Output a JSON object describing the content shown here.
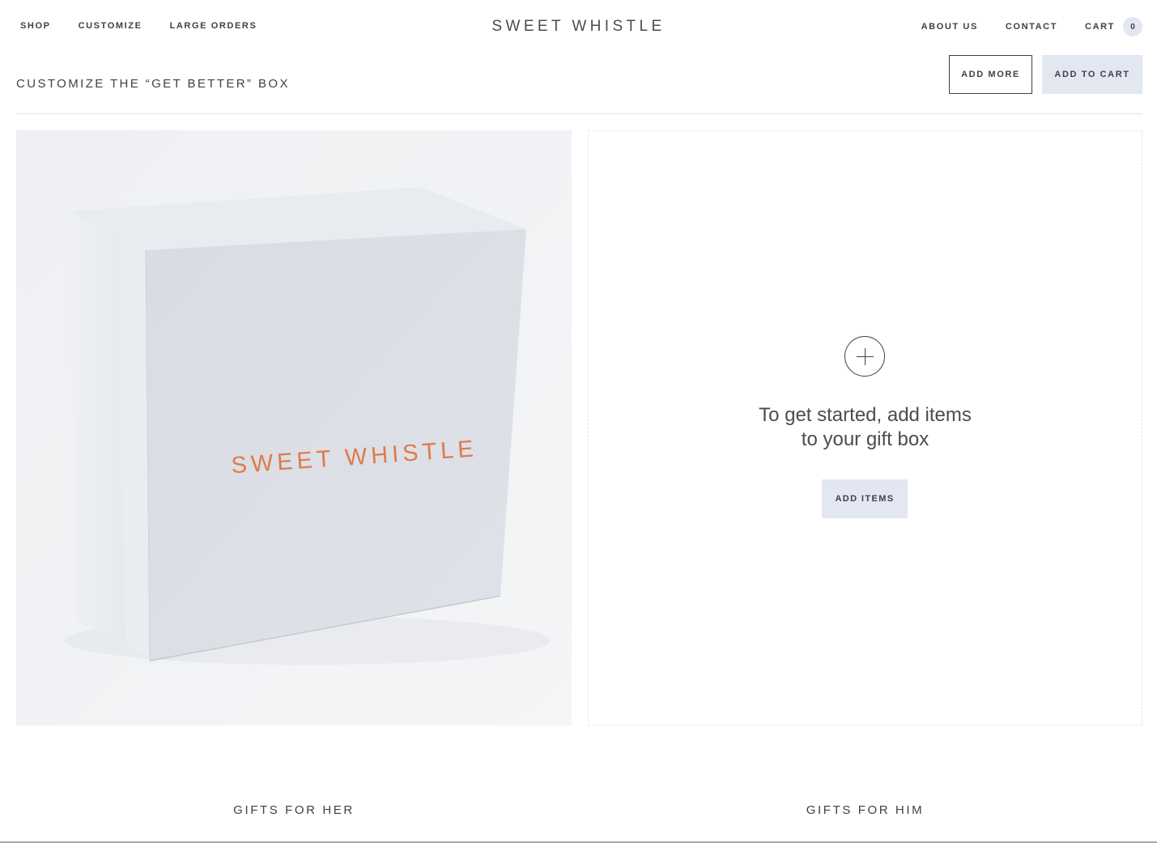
{
  "nav": {
    "left": [
      {
        "label": "SHOP"
      },
      {
        "label": "CUSTOMIZE"
      },
      {
        "label": "LARGE ORDERS"
      }
    ],
    "brand": "SWEET WHISTLE",
    "right": [
      {
        "label": "ABOUT US"
      },
      {
        "label": "CONTACT"
      }
    ],
    "cart_label": "CART",
    "cart_count": "0"
  },
  "page": {
    "title": "CUSTOMIZE THE “GET BETTER” BOX",
    "add_more_label": "ADD MORE",
    "add_to_cart_label": "ADD TO CART"
  },
  "product": {
    "box_brand": "SWEET WHISTLE",
    "box_brand_color": "#e07a4a"
  },
  "builder": {
    "message_line1": "To get started, add items",
    "message_line2": "to your gift box",
    "add_items_label": "ADD ITEMS"
  },
  "footer": {
    "links": [
      {
        "label": "GIFTS FOR HER"
      },
      {
        "label": "GIFTS FOR HIM"
      }
    ]
  },
  "colors": {
    "accent_button": "#e2e7f1",
    "text": "#3f4147"
  }
}
